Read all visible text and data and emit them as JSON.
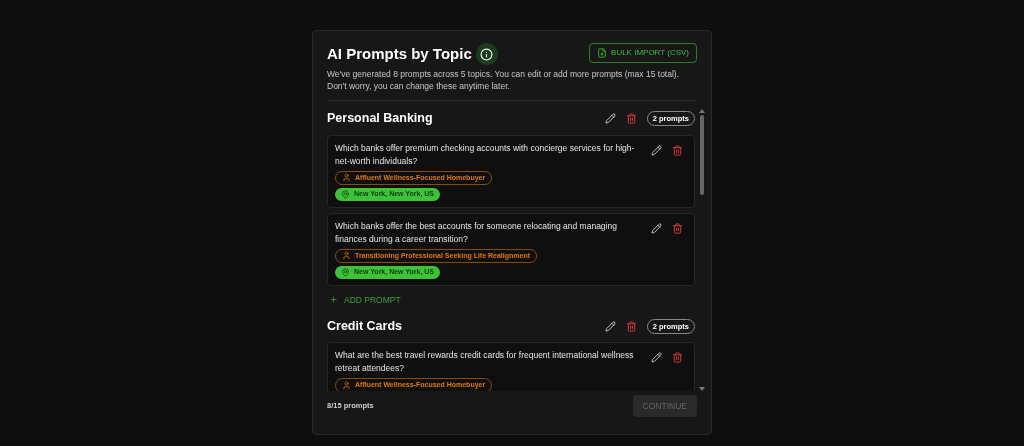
{
  "dialog": {
    "title": "AI Prompts by Topic",
    "import_button": "BULK IMPORT (CSV)",
    "description": "We've generated 8 prompts across 5 topics. You can edit or add more prompts (max 15 total). Don't worry, you can change these anytime later."
  },
  "topics": [
    {
      "name": "Personal Banking",
      "count": "2 prompts",
      "prompts": [
        {
          "text": "Which banks offer premium checking accounts with concierge services for high-net-worth individuals?",
          "tags": [
            {
              "kind": "persona",
              "label": "Affluent Wellness-Focused Homebuyer"
            },
            {
              "kind": "location",
              "label": "New York, New York, US"
            }
          ]
        },
        {
          "text": "Which banks offer the best accounts for someone relocating and managing finances during a career transition?",
          "tags": [
            {
              "kind": "persona",
              "label": "Transitioning Professional Seeking Life Realignment"
            },
            {
              "kind": "location",
              "label": "New York, New York, US"
            }
          ]
        }
      ],
      "add_label": "ADD PROMPT"
    },
    {
      "name": "Credit Cards",
      "count": "2 prompts",
      "prompts": [
        {
          "text": "What are the best travel rewards credit cards for frequent international wellness retreat attendees?",
          "tags": [
            {
              "kind": "persona",
              "label": "Affluent Wellness-Focused Homebuyer"
            }
          ]
        }
      ]
    }
  ],
  "footer": {
    "count": "8/15 prompts",
    "continue_button": {
      "label": "CONTINUE",
      "disabled": true
    }
  }
}
